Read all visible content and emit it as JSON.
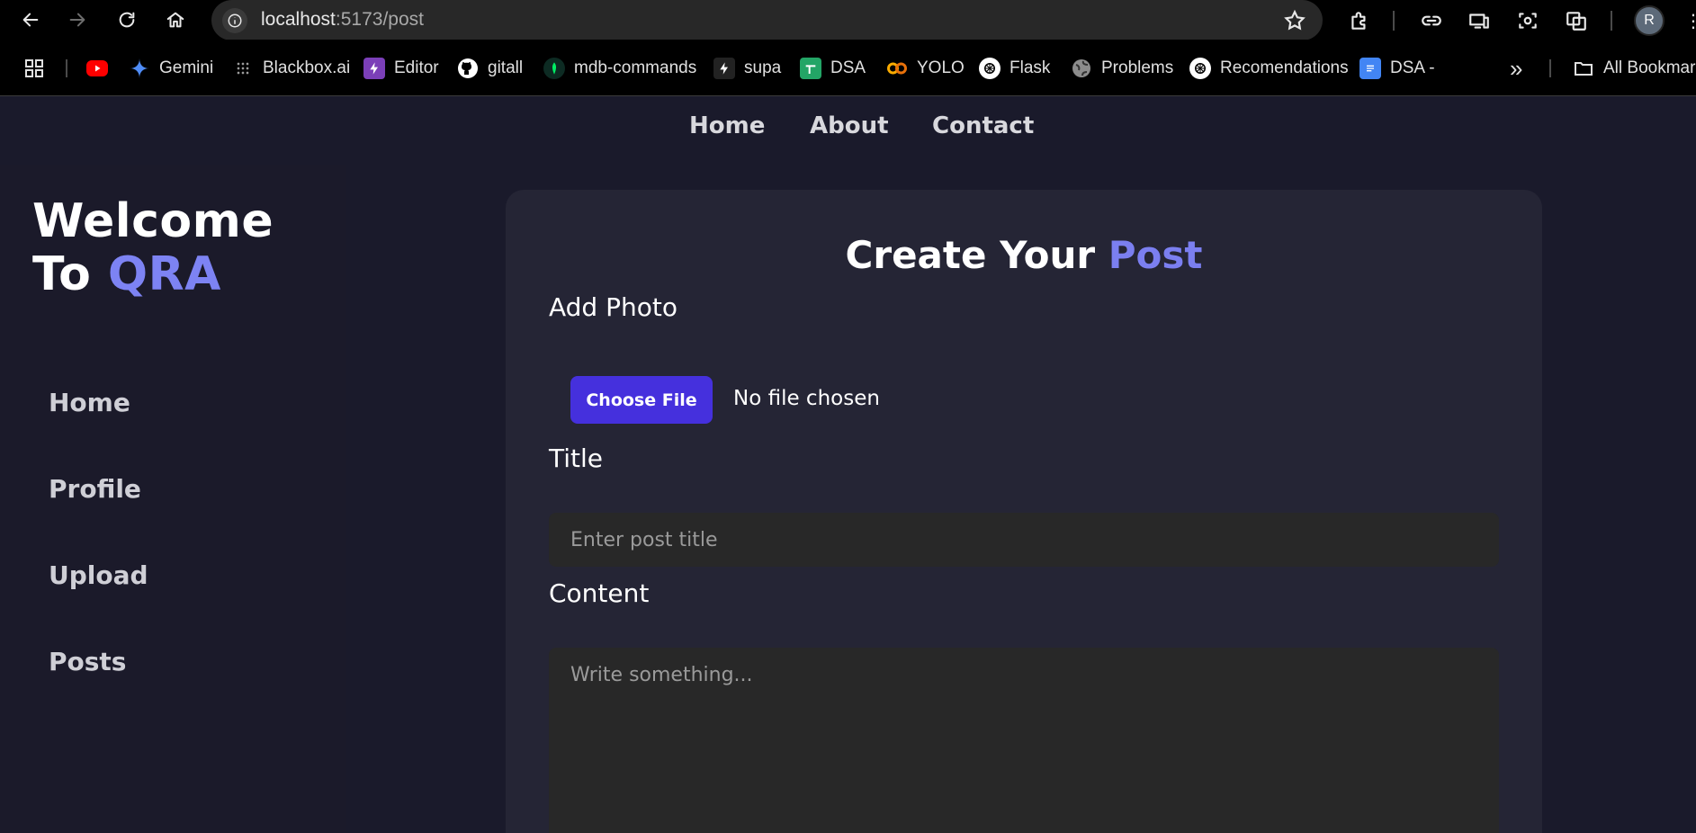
{
  "browser": {
    "url_host": "localhost",
    "url_path": ":5173/post",
    "profile_initial": "R"
  },
  "bookmarks": [
    {
      "label": "",
      "icon": "youtube-icon",
      "color": "#ff0000"
    },
    {
      "label": "Gemini",
      "icon": "gemini-icon",
      "color": "#4f8cf7"
    },
    {
      "label": "Blackbox.ai",
      "icon": "blackbox-icon",
      "color": "#9a9a9a"
    },
    {
      "label": "Editor",
      "icon": "bolt-icon",
      "color": "#7b3fb8"
    },
    {
      "label": "gitall",
      "icon": "github-icon",
      "color": "#ffffff"
    },
    {
      "label": "mdb-commands",
      "icon": "mongodb-icon",
      "color": "#00ed64"
    },
    {
      "label": "supa",
      "icon": "bolt-icon",
      "color": "#ffffff"
    },
    {
      "label": "DSA",
      "icon": "sheets-icon",
      "color": "#23a566"
    },
    {
      "label": "YOLO",
      "icon": "colab-icon",
      "color": "#f9ab00"
    },
    {
      "label": "Flask",
      "icon": "openai-icon",
      "color": "#ffffff"
    },
    {
      "label": "Problems",
      "icon": "globe-icon",
      "color": "#a0a0a0"
    },
    {
      "label": "Recomendations",
      "icon": "openai-icon",
      "color": "#ffffff"
    },
    {
      "label": "DSA -",
      "icon": "docs-icon",
      "color": "#4285f4"
    }
  ],
  "bookmarks_overflow": "»",
  "all_bookmarks": "All Bookmarks",
  "topnav": {
    "home": "Home",
    "about": "About",
    "contact": "Contact"
  },
  "sidebar": {
    "welcome_line1": "Welcome",
    "welcome_to": "To",
    "welcome_brand": "QRA",
    "items": [
      "Home",
      "Profile",
      "Upload",
      "Posts"
    ]
  },
  "form": {
    "title_main": "Create Your",
    "title_accent": "Post",
    "photo_label": "Add Photo",
    "choose_file": "Choose File",
    "no_file": "No file chosen",
    "title_label": "Title",
    "title_placeholder": "Enter post title",
    "content_label": "Content",
    "content_placeholder": "Write something..."
  },
  "colors": {
    "accent": "#7b7ff0",
    "button": "#4530dd",
    "card": "#252535",
    "page_bg": "#1a1a2b"
  }
}
